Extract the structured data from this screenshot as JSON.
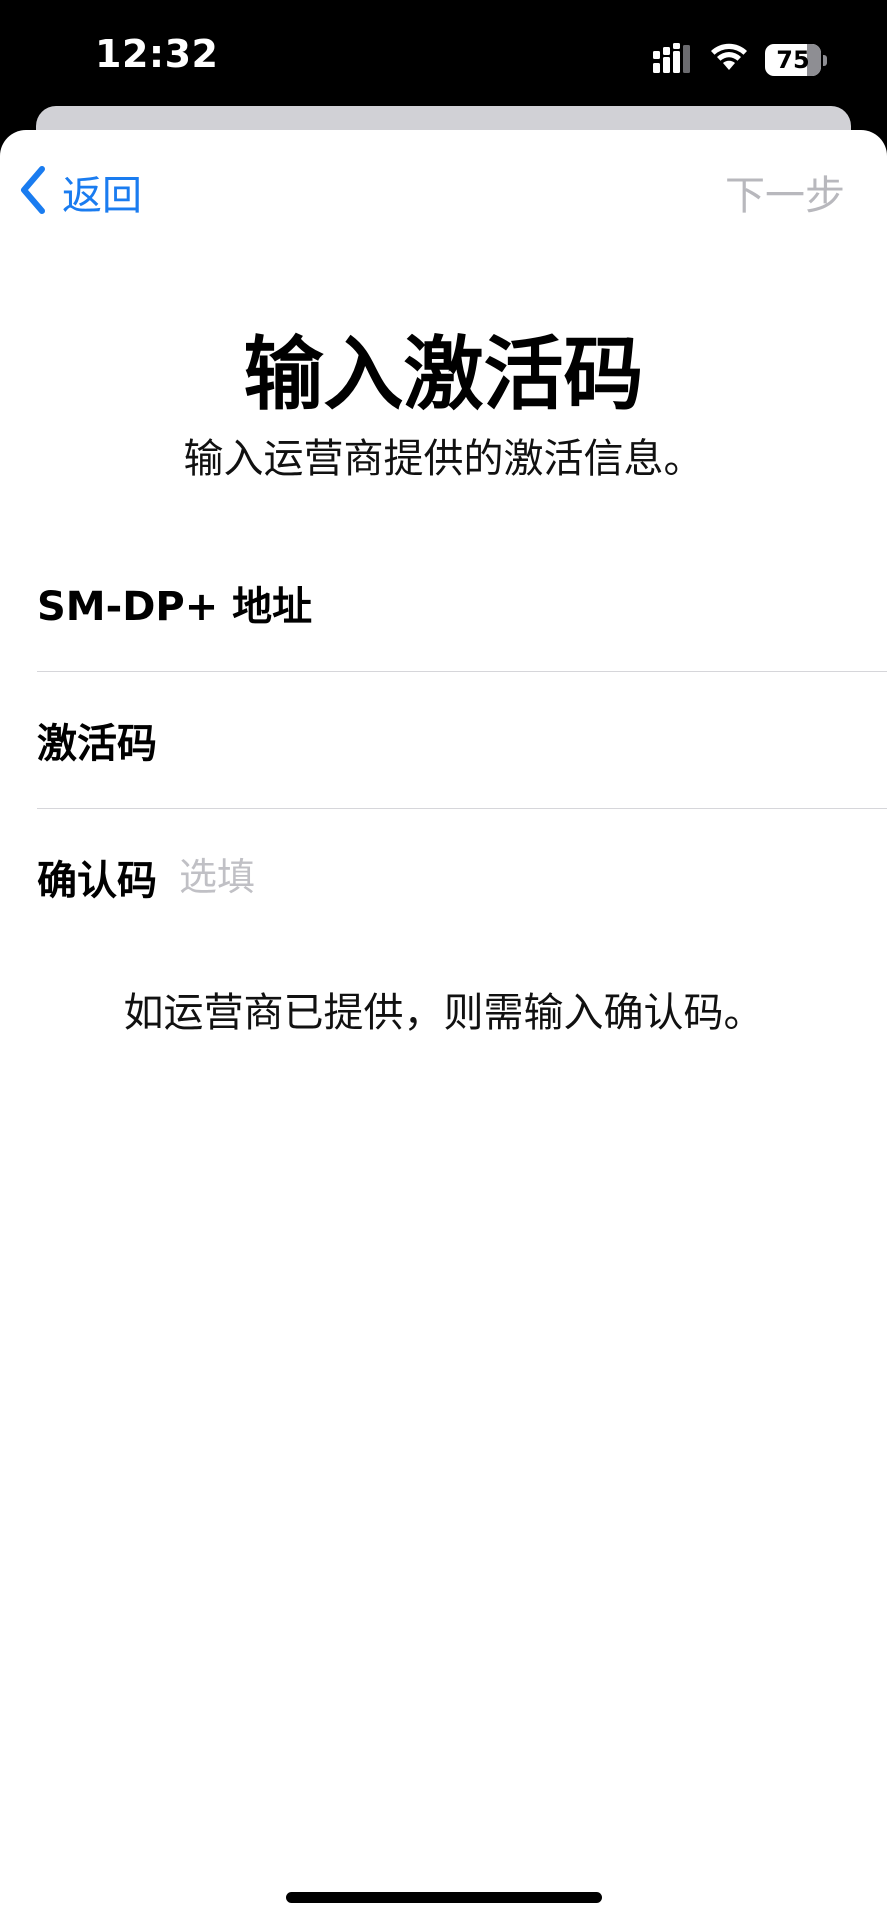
{
  "status_bar": {
    "time": "12:32",
    "battery_level": "75",
    "battery_fraction": 0.75,
    "icons": [
      "cellular-signal-icon",
      "wifi-icon",
      "battery-icon"
    ]
  },
  "nav": {
    "back_label": "返回",
    "next_label": "下一步"
  },
  "header": {
    "title": "输入激活码",
    "subtitle": "输入运营商提供的激活信息。"
  },
  "form": {
    "fields": [
      {
        "label": "SM-DP+ 地址",
        "value": "",
        "placeholder": ""
      },
      {
        "label": "激活码",
        "value": "",
        "placeholder": ""
      },
      {
        "label": "确认码",
        "value": "",
        "placeholder": "选填"
      }
    ],
    "footnote": "如运营商已提供，则需输入确认码。"
  },
  "colors": {
    "accent": "#1a7cf0",
    "disabled": "#b8b8bd",
    "placeholder": "#c0c0c5",
    "separator": "#d6d6da"
  }
}
